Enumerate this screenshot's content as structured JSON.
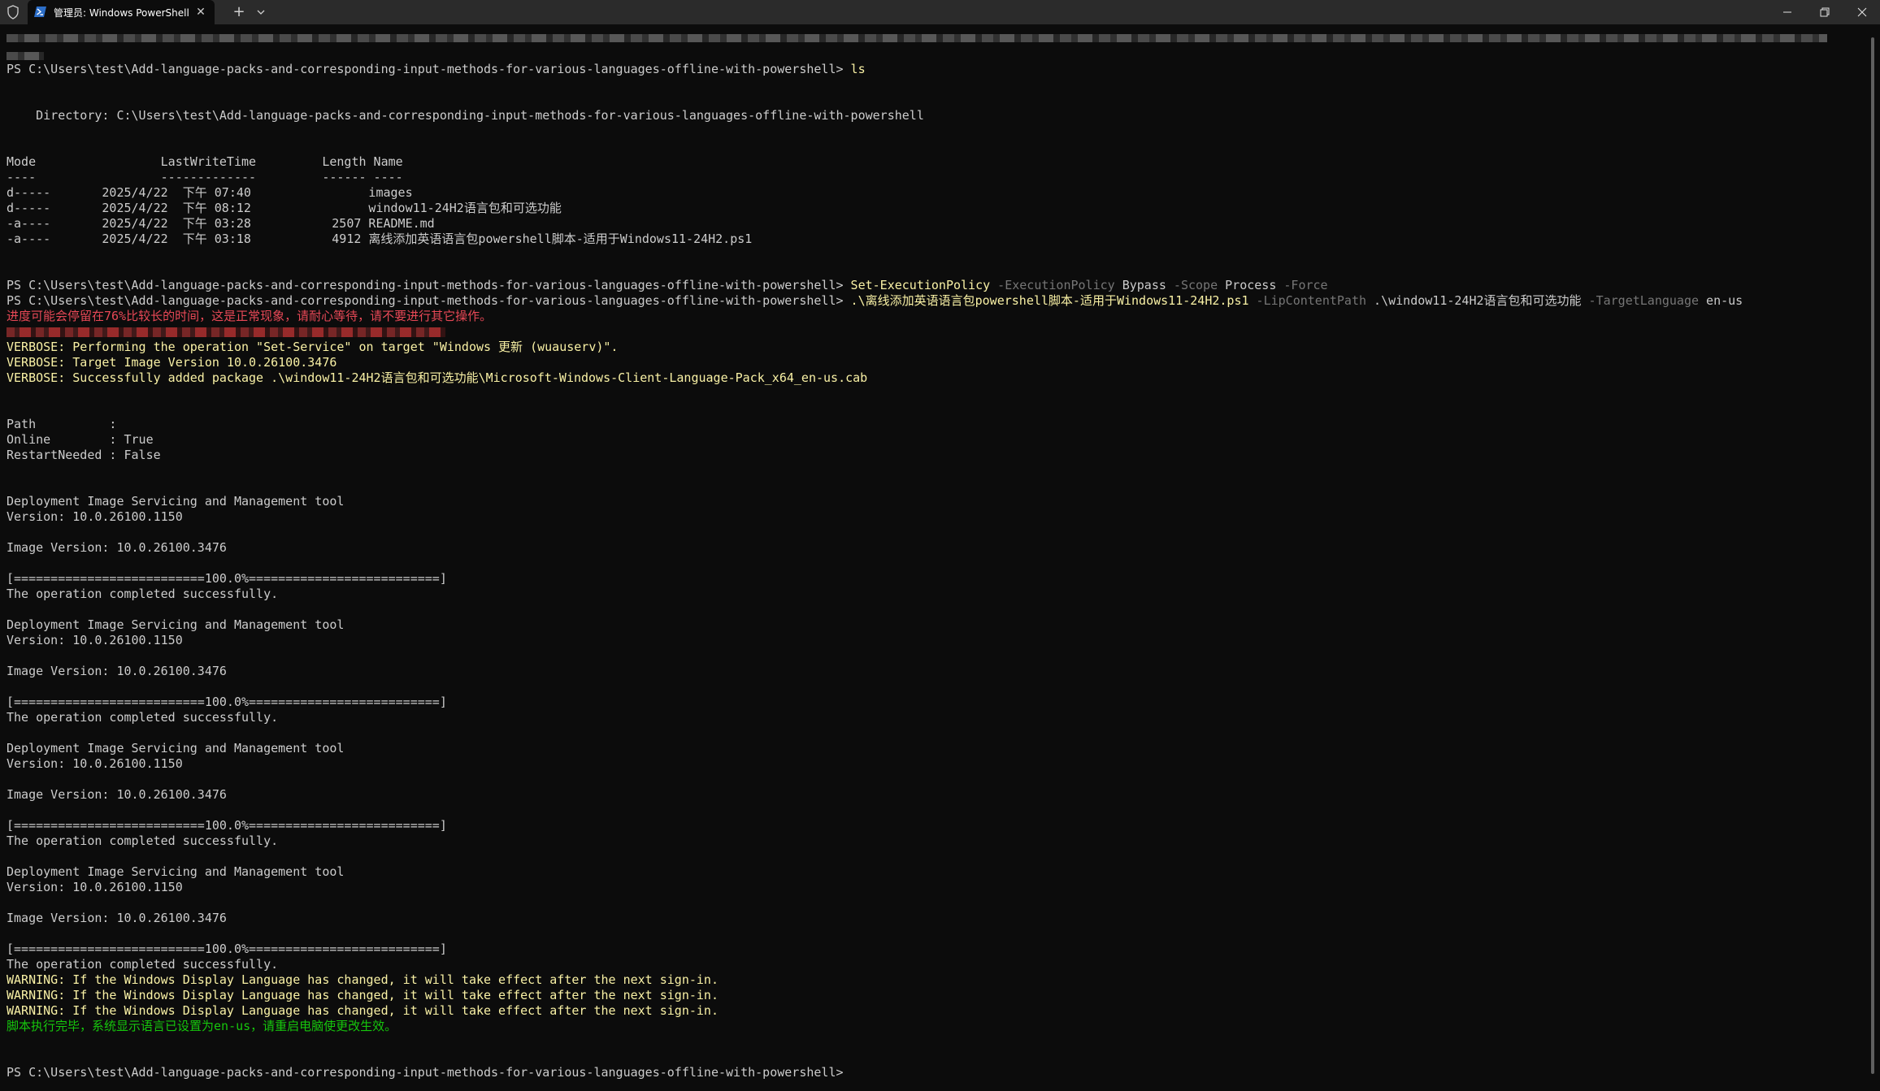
{
  "window": {
    "tab_title": "管理员: Windows PowerShell",
    "tab_close_glyph": "✕",
    "new_tab_glyph": "+",
    "icons": {
      "shield": "shield-icon",
      "tab": "powershell-icon",
      "dropdown": "chevron-down-icon",
      "minimize": "minimize-icon",
      "maximize": "restore-icon",
      "close": "close-icon"
    }
  },
  "colors": {
    "background": "#0c0c0c",
    "titlebar": "#2b2b2b",
    "text": "#cccccc",
    "command": "#f9f1a5",
    "parameter": "#767676",
    "warning": "#f9f1a5",
    "error": "#e74856",
    "success": "#16c60c"
  },
  "terminal": {
    "prompt": "PS C:\\Users\\test\\Add-language-packs-and-corresponding-input-methods-for-various-languages-offline-with-powershell> ",
    "cmd_ls": "ls",
    "directory_line": "    Directory: C:\\Users\\test\\Add-language-packs-and-corresponding-input-methods-for-various-languages-offline-with-powershell",
    "listing": {
      "header": "Mode                 LastWriteTime         Length Name",
      "separator": "----                 -------------         ------ ----",
      "rows": [
        "d-----       2025/4/22  下午 07:40                images",
        "d-----       2025/4/22  下午 08:12                window11-24H2语言包和可选功能",
        "-a----       2025/4/22  下午 03:28           2507 README.md",
        "-a----       2025/4/22  下午 03:18           4912 离线添加英语语言包powershell脚本-适用于Windows11-24H2.ps1"
      ]
    },
    "cmd1": {
      "command": "Set-ExecutionPolicy",
      "p1": " -ExecutionPolicy",
      "a1": " Bypass",
      "p2": " -Scope",
      "a2": " Process",
      "p3": " -Force"
    },
    "cmd2": {
      "command": ".\\离线添加英语语言包powershell脚本-适用于Windows11-24H2.ps1",
      "p1": " -LipContentPath",
      "a1": " .\\window11-24H2语言包和可选功能",
      "p2": " -TargetLanguage",
      "a2": " en-us"
    },
    "progress_note": "进度可能会停留在76%比较长的时间，这是正常现象，请耐心等待，请不要进行其它操作。",
    "verbose": [
      "VERBOSE: Performing the operation \"Set-Service\" on target \"Windows 更新 (wuauserv)\".",
      "VERBOSE: Target Image Version 10.0.26100.3476",
      "VERBOSE: Successfully added package .\\window11-24H2语言包和可选功能\\Microsoft-Windows-Client-Language-Pack_x64_en-us.cab"
    ],
    "result": {
      "path": "Path          :",
      "online": "Online        : True",
      "restart": "RestartNeeded : False"
    },
    "dism": {
      "tool": "Deployment Image Servicing and Management tool",
      "version": "Version: 10.0.26100.1150",
      "image_version": "Image Version: 10.0.26100.3476",
      "progress": "[==========================100.0%==========================]",
      "completed": "The operation completed successfully."
    },
    "warning": "WARNING: If the Windows Display Language has changed, it will take effect after the next sign-in.",
    "final_message": "脚本执行完毕，系统显示语言已设置为en-us，请重启电脑使更改生效。"
  }
}
